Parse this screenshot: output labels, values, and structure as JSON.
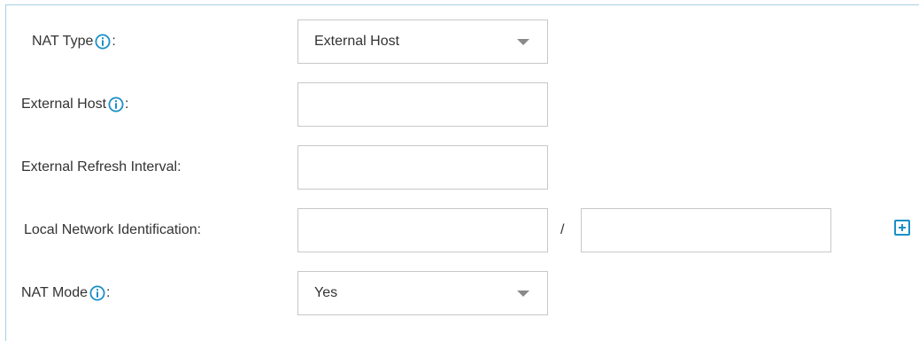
{
  "form": {
    "nat_type": {
      "label": "NAT Type",
      "suffix": ":",
      "value": "External Host"
    },
    "external_host": {
      "label": "External Host",
      "suffix": ":",
      "value": ""
    },
    "external_refresh_interval": {
      "label": "External Refresh Interval:",
      "value": ""
    },
    "local_network_identification": {
      "label": "Local Network Identification:",
      "network_value": "",
      "separator": "/",
      "mask_value": ""
    },
    "nat_mode": {
      "label": "NAT Mode",
      "suffix": ":",
      "value": "Yes"
    }
  },
  "colors": {
    "accent": "#1a8fc7",
    "border": "#c8c8c8",
    "panel_border": "#a9cfe0"
  },
  "icons": {
    "info": "info-circle-icon",
    "add": "plus-square-icon",
    "dropdown": "caret-down-icon"
  }
}
